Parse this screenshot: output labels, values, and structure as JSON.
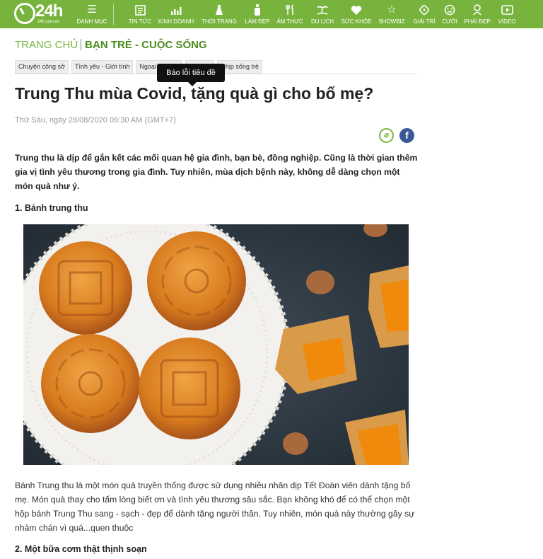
{
  "logo": {
    "number": "24h",
    "sub": "24h.com.vn"
  },
  "nav": {
    "menu": "DANH MỤC",
    "items": [
      "TIN TỨC",
      "KINH DOANH",
      "THỜI TRANG",
      "LÀM ĐẸP",
      "ẨM THỰC",
      "DU LỊCH",
      "SỨC KHỎE",
      "SHOWBIZ",
      "GIẢI TRÍ",
      "CƯỜI",
      "PHÁI ĐẸP",
      "VIDEO"
    ]
  },
  "breadcrumb": {
    "home": "TRANG CHỦ",
    "category": "BẠN TRẺ - CUỘC SỐNG"
  },
  "subtags": [
    "Chuyện công sở",
    "Tình yêu - Giới tính",
    "Ngoại tì",
    "Hot boy",
    "Nhịp sống trẻ"
  ],
  "tooltip": "Báo lỗi tiêu đề",
  "article": {
    "title": "Trung Thu mùa Covid, tặng quà gì cho bố mẹ?",
    "date": "Thứ Sáu, ngày 28/08/2020 09:30 AM (GMT+7)",
    "lead": "Trung thu là dịp để gắn kết các mối quan hệ gia đình, bạn bè, đồng nghiệp. Cũng là thời gian thêm gia vị tình yêu thương trong gia đình. Tuy nhiên, mùa dịch bệnh này, không dễ dàng chọn một món quà như ý.",
    "heading1": "1. Bánh trung thu",
    "para1": "Bánh Trung thu là một món quà truyền thống được sử dụng nhiều nhân dịp Tết Đoàn viên dành tặng bố mẹ. Món quà thay cho tấm lòng biết ơn và tình yêu thương sâu sắc. Bạn không khó để có thể chọn một hộp bánh Trung Thu sang - sạch - đẹp để dành tặng người thân. Tuy nhiên, món quà này thường gây sự nhàm chán vì quá...quen thuộc",
    "heading2": "2. Một bữa cơm thật thịnh soạn"
  },
  "share": {
    "fb": "f",
    "brand": "24h-icon"
  },
  "colors": {
    "brand": "#78b43d",
    "facebook": "#3b5998"
  }
}
